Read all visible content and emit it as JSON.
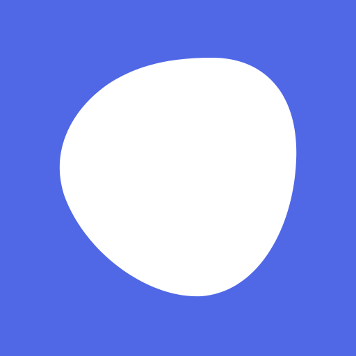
{
  "colors": {
    "background": "#5068E6",
    "blob": "#FFFFFF"
  },
  "icon": {
    "name": "white-blob-shape"
  }
}
